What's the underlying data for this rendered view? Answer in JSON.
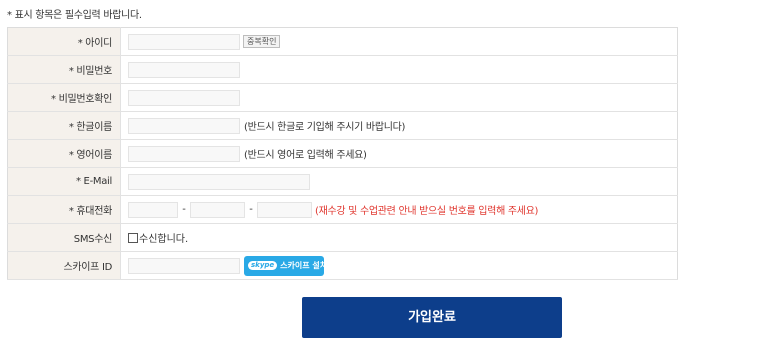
{
  "note": "* 표시 항목은 필수입력 바랍니다.",
  "rows": {
    "id": {
      "label": "* 아이디",
      "check_button": "중복확인"
    },
    "password": {
      "label": "* 비밀번호"
    },
    "password_confirm": {
      "label": "* 비밀번호확인"
    },
    "korean_name": {
      "label": "* 한글이름",
      "hint": "(반드시 한글로 기입해 주시기 바랍니다)"
    },
    "english_name": {
      "label": "* 영어이름",
      "hint": "(반드시 영어로 입력해 주세요)"
    },
    "email": {
      "label": "* E-Mail"
    },
    "mobile": {
      "label": "* 휴대전화",
      "separator": "-",
      "hint": "(재수강 및 수업관련 안내 받으실 번호를 입력해 주세요)"
    },
    "sms": {
      "label": "SMS수신",
      "checkbox_label": "수신합니다.",
      "checked": false
    },
    "skype": {
      "label": "스카이프 ID",
      "logo": "skype",
      "install_button": "스카이프 설치"
    }
  },
  "submit_label": "가입완료",
  "colors": {
    "label_bg": "#f5f1ec",
    "hint_red": "#e0362e",
    "submit_bg": "#0d3e8b",
    "skype_blue": "#29a9e6"
  }
}
